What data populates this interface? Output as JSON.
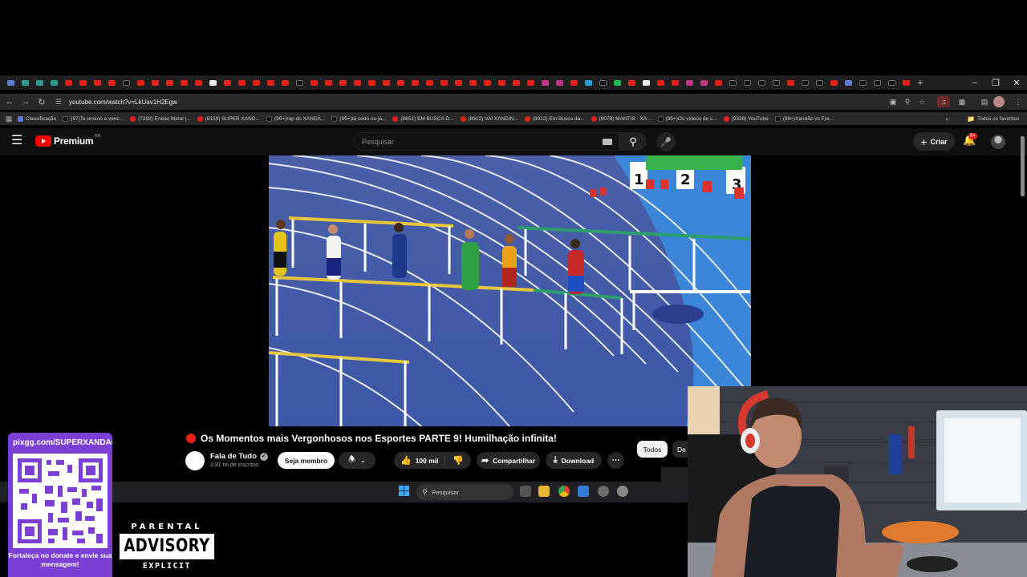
{
  "browser": {
    "url": "youtube.com/watch?v=LkUav1H2Egw",
    "all_bookmarks_label": "Todos os favoritos",
    "bookmarks": [
      {
        "icon": "classificacao-icon",
        "label": "Classificação"
      },
      {
        "icon": "tiktok-icon",
        "label": "(97)Te ensino a venc..."
      },
      {
        "icon": "youtube-icon",
        "label": "(7292) Enéas Metal |..."
      },
      {
        "icon": "youtube-icon",
        "label": "(8159) SUPER XAND..."
      },
      {
        "icon": "tiktok-icon",
        "label": "(99+)rap do XANDÃ..."
      },
      {
        "icon": "tiktok-icon",
        "label": "(99+)tá cedo ou já..."
      },
      {
        "icon": "youtube-icon",
        "label": "(8851) EM BUSCA D..."
      },
      {
        "icon": "youtube-icon",
        "label": "(8912) VAI XANDIN..."
      },
      {
        "icon": "youtube-icon",
        "label": "(8912) Em Busca da..."
      },
      {
        "icon": "youtube-icon",
        "label": "(9078) MANTIS · XA..."
      },
      {
        "icon": "tiktok-icon",
        "label": "(99+)Os vídeos de c..."
      },
      {
        "icon": "youtube-icon",
        "label": "(9338) YouTube"
      },
      {
        "icon": "tiktok-icon",
        "label": "(99+)Xandão vs Fra..."
      }
    ]
  },
  "youtube": {
    "brand": "Premium",
    "region": "BR",
    "search_placeholder": "Pesquisar",
    "create_label": "Criar",
    "notification_badge": "9+"
  },
  "video": {
    "title": "Os Momentos mais Vergonhosos nos Esportes PARTE 9! Humilhação infinita!",
    "channel": "Fala de Tudo",
    "subscribers": "2,91 mi de inscritos",
    "join_label": "Seja membro",
    "likes": "100 mil",
    "share_label": "Compartilhar",
    "download_label": "Download",
    "lane_numbers": [
      "1",
      "2",
      "3"
    ]
  },
  "chips": {
    "all": "Todos",
    "second": "De"
  },
  "taskbar": {
    "search_placeholder": "Pesquisar"
  },
  "overlay": {
    "pix_url": "pixgg.com/SUPERXANDAO",
    "donate_message": "Fortaleça no donate e envie sua mensagem!",
    "parental_top": "PARENTAL",
    "parental_middle": "ADVISORY",
    "parental_bottom": "EXPLICIT CONTENT"
  },
  "colors": {
    "youtube_red": "#ff0000",
    "donate_purple": "#7b3fd6",
    "track_blue": "#3a67c4",
    "header_bg": "#0f0f0f"
  }
}
